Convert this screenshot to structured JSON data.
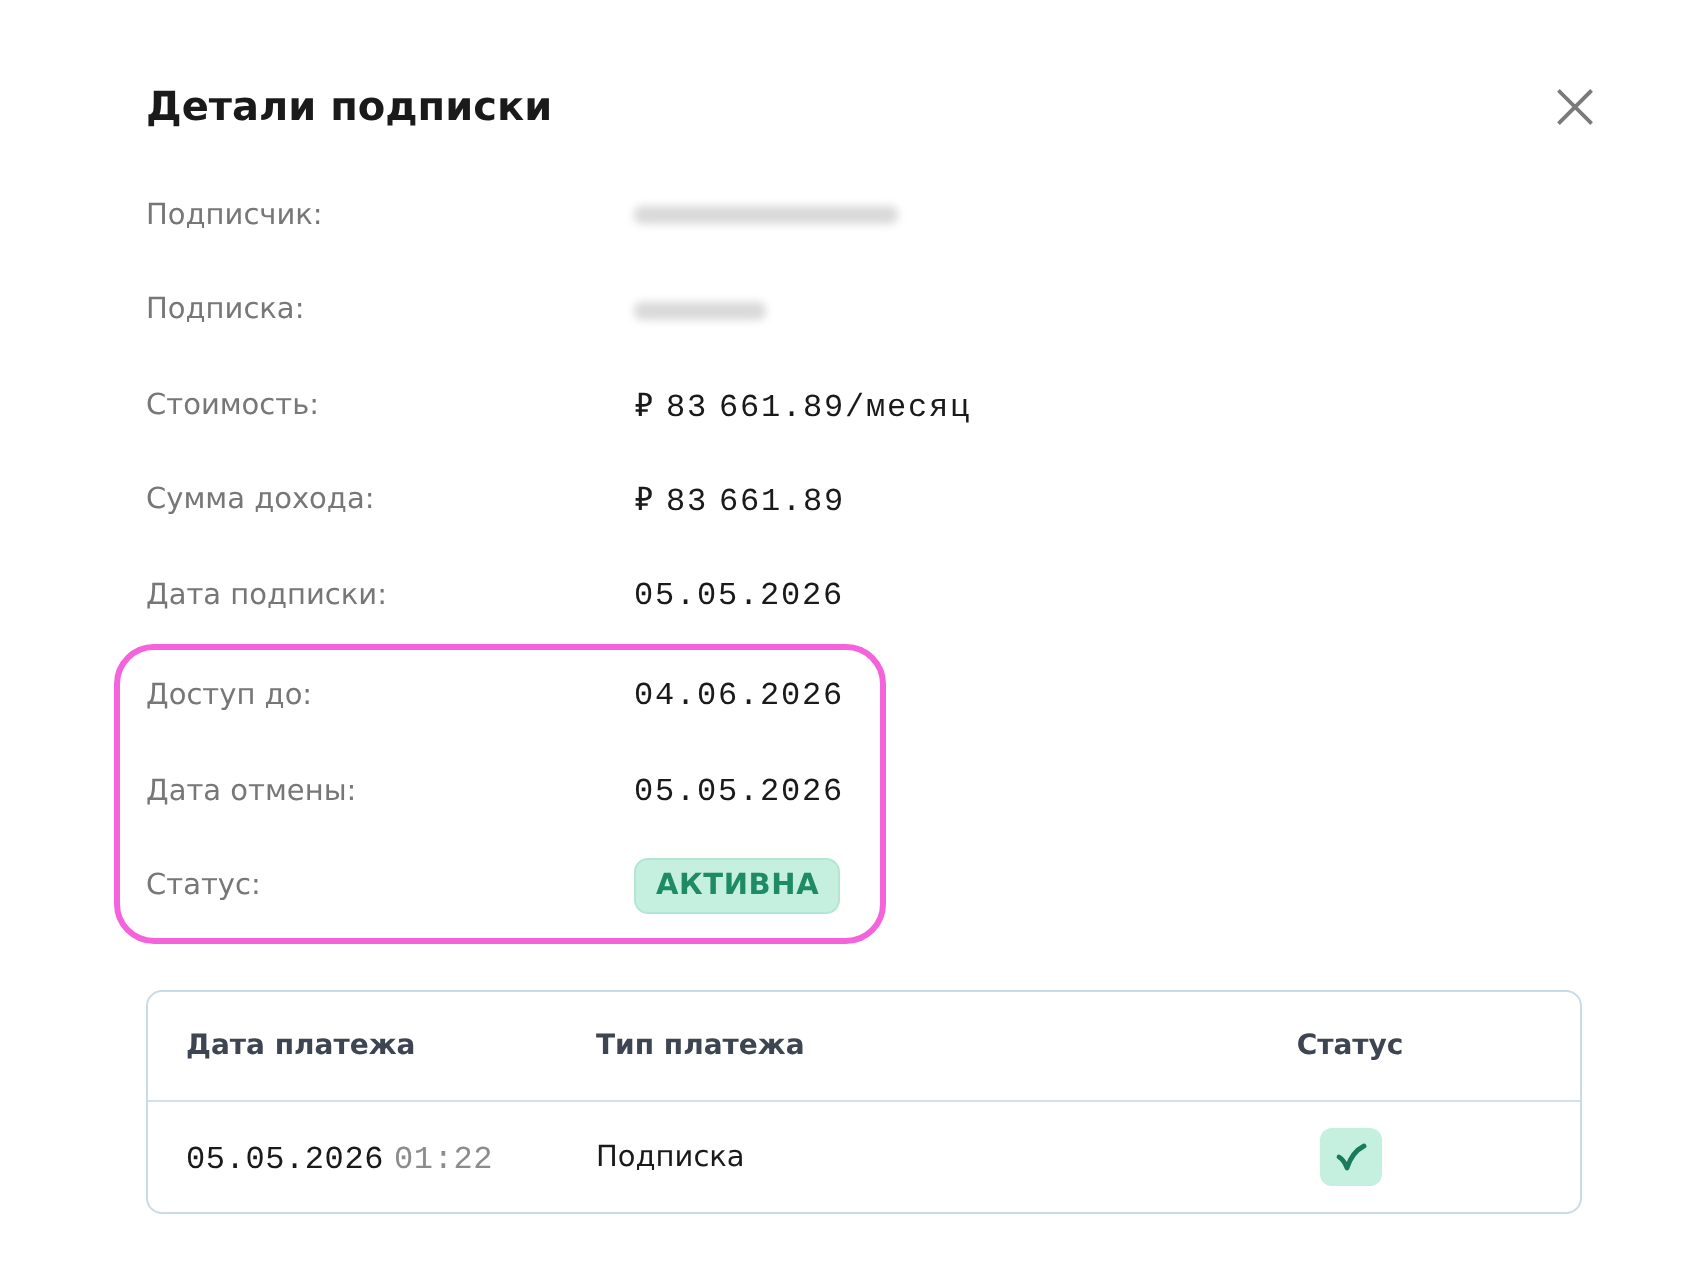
{
  "dialog": {
    "title": "Детали подписки"
  },
  "fields": [
    {
      "label": "Подписчик:",
      "kind": "redacted_long",
      "highlighted": false
    },
    {
      "label": "Подписка:",
      "kind": "redacted_short",
      "highlighted": false
    },
    {
      "label": "Стоимость:",
      "kind": "text",
      "value": "₽ 83 661.89/месяц",
      "highlighted": false
    },
    {
      "label": "Сумма дохода:",
      "kind": "text",
      "value": "₽ 83 661.89",
      "highlighted": false
    },
    {
      "label": "Дата подписки:",
      "kind": "text",
      "value": "05.05.2026",
      "highlighted": false
    },
    {
      "label": "Доступ до:",
      "kind": "text",
      "value": "04.06.2026",
      "highlighted": true
    },
    {
      "label": "Дата отмены:",
      "kind": "text",
      "value": "05.05.2026",
      "highlighted": true
    },
    {
      "label": "Статус:",
      "kind": "badge",
      "value": "АКТИВНА",
      "highlighted": true
    }
  ],
  "payments": {
    "columns": [
      "Дата платежа",
      "Тип платежа",
      "Статус"
    ],
    "rows": [
      {
        "date": "05.05.2026",
        "time": "01:22",
        "type": "Подписка",
        "paid": true
      }
    ]
  }
}
